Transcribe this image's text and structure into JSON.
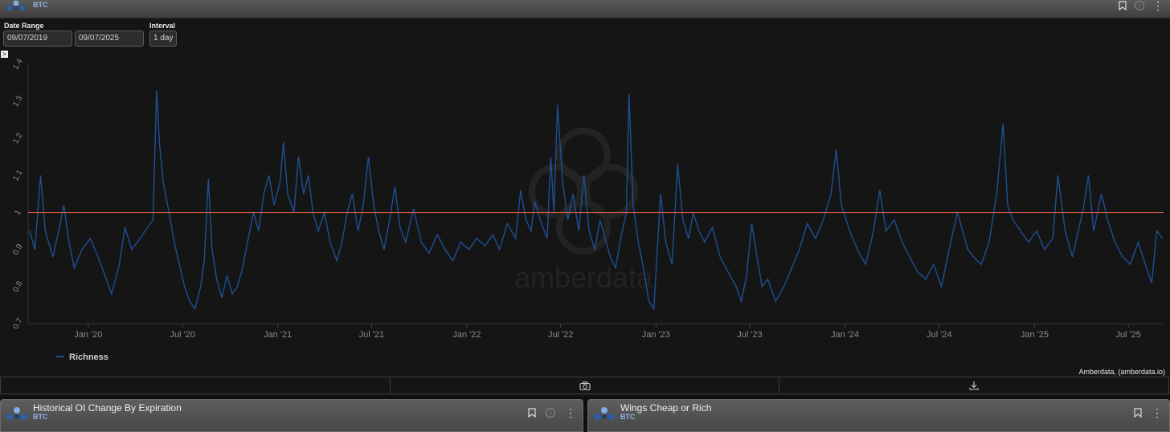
{
  "header": {
    "subtitle": "BTC",
    "info_icon": "info-icon",
    "bookmark_icon": "bookmark-icon",
    "menu_icon": "more-vertical-icon"
  },
  "controls": {
    "date_range_label": "Date Range",
    "start_date": "09/07/2019",
    "end_date": "09/07/2025",
    "interval_label": "Interval",
    "interval_value": "1 day",
    "expand_glyph": ">"
  },
  "watermark": "amberdata",
  "credit": "Amberdata, (amberdata.io)",
  "toolbar": {
    "camera_icon": "camera-icon",
    "download_icon": "download-icon"
  },
  "cards": [
    {
      "title": "Historical OI Change By Expiration",
      "subtitle": "BTC"
    },
    {
      "title": "Wings Cheap or Rich",
      "subtitle": "BTC"
    }
  ],
  "colors": {
    "series": "#1f4f93",
    "reference_line": "#e0604a",
    "background": "#151515"
  },
  "chart_data": {
    "type": "line",
    "xlabel": "",
    "ylabel": "",
    "ylim": [
      0.7,
      1.4
    ],
    "y_ticks": [
      0.7,
      0.8,
      0.9,
      1,
      1.1,
      1.2,
      1.3,
      1.4
    ],
    "y_tick_labels": [
      "0.7",
      "0.8",
      "0.9",
      "1",
      "1.1",
      "1.2",
      "1.3",
      "1.4"
    ],
    "x_range": [
      "2019-09-07",
      "2025-09-07"
    ],
    "x_ticks": [
      "2020-01-01",
      "2020-07-01",
      "2021-01-01",
      "2021-07-01",
      "2022-01-01",
      "2022-07-01",
      "2023-01-01",
      "2023-07-01",
      "2024-01-01",
      "2024-07-01",
      "2025-01-01",
      "2025-07-01"
    ],
    "x_tick_labels": [
      "Jan '20",
      "Jul '20",
      "Jan '21",
      "Jul '21",
      "Jan '22",
      "Jul '22",
      "Jan '23",
      "Jul '23",
      "Jan '24",
      "Jul '24",
      "Jan '25",
      "Jul '25"
    ],
    "reference_line": {
      "y": 1
    },
    "legend": {
      "placement": "bottom-left"
    },
    "grid": false,
    "series": [
      {
        "name": "Richness",
        "points": [
          [
            "2019-09-10",
            0.95
          ],
          [
            "2019-09-20",
            0.9
          ],
          [
            "2019-10-01",
            1.1
          ],
          [
            "2019-10-10",
            0.95
          ],
          [
            "2019-10-25",
            0.88
          ],
          [
            "2019-11-05",
            0.95
          ],
          [
            "2019-11-15",
            1.02
          ],
          [
            "2019-11-25",
            0.92
          ],
          [
            "2019-12-05",
            0.85
          ],
          [
            "2019-12-20",
            0.9
          ],
          [
            "2020-01-05",
            0.93
          ],
          [
            "2020-01-20",
            0.88
          ],
          [
            "2020-02-05",
            0.82
          ],
          [
            "2020-02-15",
            0.78
          ],
          [
            "2020-03-01",
            0.86
          ],
          [
            "2020-03-12",
            0.96
          ],
          [
            "2020-03-25",
            0.9
          ],
          [
            "2020-04-10",
            0.93
          ],
          [
            "2020-04-25",
            0.96
          ],
          [
            "2020-05-05",
            0.98
          ],
          [
            "2020-05-12",
            1.33
          ],
          [
            "2020-05-18",
            1.18
          ],
          [
            "2020-05-25",
            1.08
          ],
          [
            "2020-06-05",
            1.0
          ],
          [
            "2020-06-15",
            0.92
          ],
          [
            "2020-06-25",
            0.86
          ],
          [
            "2020-07-05",
            0.8
          ],
          [
            "2020-07-15",
            0.76
          ],
          [
            "2020-07-25",
            0.74
          ],
          [
            "2020-08-05",
            0.8
          ],
          [
            "2020-08-12",
            0.87
          ],
          [
            "2020-08-20",
            1.09
          ],
          [
            "2020-08-27",
            0.9
          ],
          [
            "2020-09-05",
            0.82
          ],
          [
            "2020-09-15",
            0.77
          ],
          [
            "2020-09-25",
            0.83
          ],
          [
            "2020-10-05",
            0.78
          ],
          [
            "2020-10-15",
            0.8
          ],
          [
            "2020-10-25",
            0.85
          ],
          [
            "2020-11-05",
            0.93
          ],
          [
            "2020-11-15",
            1.0
          ],
          [
            "2020-11-25",
            0.95
          ],
          [
            "2020-12-05",
            1.05
          ],
          [
            "2020-12-15",
            1.1
          ],
          [
            "2020-12-25",
            1.02
          ],
          [
            "2021-01-05",
            1.08
          ],
          [
            "2021-01-12",
            1.19
          ],
          [
            "2021-01-20",
            1.05
          ],
          [
            "2021-02-01",
            1.0
          ],
          [
            "2021-02-10",
            1.15
          ],
          [
            "2021-02-20",
            1.05
          ],
          [
            "2021-03-01",
            1.1
          ],
          [
            "2021-03-10",
            1.0
          ],
          [
            "2021-03-20",
            0.95
          ],
          [
            "2021-04-01",
            1.0
          ],
          [
            "2021-04-12",
            0.92
          ],
          [
            "2021-04-25",
            0.87
          ],
          [
            "2021-05-05",
            0.92
          ],
          [
            "2021-05-15",
            1.0
          ],
          [
            "2021-05-25",
            1.05
          ],
          [
            "2021-06-05",
            0.95
          ],
          [
            "2021-06-15",
            1.02
          ],
          [
            "2021-06-25",
            1.15
          ],
          [
            "2021-07-05",
            1.02
          ],
          [
            "2021-07-15",
            0.95
          ],
          [
            "2021-07-25",
            0.9
          ],
          [
            "2021-08-05",
            0.98
          ],
          [
            "2021-08-15",
            1.07
          ],
          [
            "2021-08-25",
            0.96
          ],
          [
            "2021-09-05",
            0.92
          ],
          [
            "2021-09-20",
            1.01
          ],
          [
            "2021-10-05",
            0.92
          ],
          [
            "2021-10-20",
            0.89
          ],
          [
            "2021-11-05",
            0.94
          ],
          [
            "2021-11-20",
            0.9
          ],
          [
            "2021-12-05",
            0.87
          ],
          [
            "2021-12-20",
            0.92
          ],
          [
            "2022-01-05",
            0.9
          ],
          [
            "2022-01-20",
            0.93
          ],
          [
            "2022-02-05",
            0.91
          ],
          [
            "2022-02-20",
            0.94
          ],
          [
            "2022-03-05",
            0.9
          ],
          [
            "2022-03-20",
            0.97
          ],
          [
            "2022-04-05",
            0.93
          ],
          [
            "2022-04-15",
            1.06
          ],
          [
            "2022-04-25",
            0.98
          ],
          [
            "2022-05-05",
            0.95
          ],
          [
            "2022-05-12",
            1.03
          ],
          [
            "2022-05-25",
            0.97
          ],
          [
            "2022-06-05",
            0.93
          ],
          [
            "2022-06-12",
            1.15
          ],
          [
            "2022-06-18",
            1.0
          ],
          [
            "2022-06-25",
            1.29
          ],
          [
            "2022-07-05",
            1.08
          ],
          [
            "2022-07-15",
            0.98
          ],
          [
            "2022-07-25",
            1.05
          ],
          [
            "2022-08-05",
            0.95
          ],
          [
            "2022-08-15",
            1.1
          ],
          [
            "2022-08-25",
            0.95
          ],
          [
            "2022-09-05",
            0.9
          ],
          [
            "2022-09-15",
            0.98
          ],
          [
            "2022-09-25",
            0.93
          ],
          [
            "2022-10-05",
            0.88
          ],
          [
            "2022-10-15",
            0.85
          ],
          [
            "2022-10-25",
            0.93
          ],
          [
            "2022-11-05",
            1.0
          ],
          [
            "2022-11-10",
            1.32
          ],
          [
            "2022-11-18",
            1.02
          ],
          [
            "2022-11-28",
            0.92
          ],
          [
            "2022-12-08",
            0.85
          ],
          [
            "2022-12-18",
            0.76
          ],
          [
            "2022-12-28",
            0.74
          ],
          [
            "2023-01-10",
            1.05
          ],
          [
            "2023-01-20",
            0.92
          ],
          [
            "2023-02-01",
            0.86
          ],
          [
            "2023-02-12",
            1.13
          ],
          [
            "2023-02-22",
            0.98
          ],
          [
            "2023-03-05",
            0.93
          ],
          [
            "2023-03-14",
            1.0
          ],
          [
            "2023-03-25",
            0.95
          ],
          [
            "2023-04-05",
            0.92
          ],
          [
            "2023-04-20",
            0.96
          ],
          [
            "2023-05-05",
            0.88
          ],
          [
            "2023-05-20",
            0.84
          ],
          [
            "2023-06-05",
            0.8
          ],
          [
            "2023-06-15",
            0.76
          ],
          [
            "2023-06-25",
            0.83
          ],
          [
            "2023-07-05",
            0.97
          ],
          [
            "2023-07-15",
            0.88
          ],
          [
            "2023-07-25",
            0.8
          ],
          [
            "2023-08-05",
            0.82
          ],
          [
            "2023-08-20",
            0.76
          ],
          [
            "2023-09-05",
            0.8
          ],
          [
            "2023-09-20",
            0.85
          ],
          [
            "2023-10-05",
            0.9
          ],
          [
            "2023-10-20",
            0.97
          ],
          [
            "2023-11-05",
            0.93
          ],
          [
            "2023-11-20",
            0.98
          ],
          [
            "2023-12-05",
            1.05
          ],
          [
            "2023-12-15",
            1.17
          ],
          [
            "2023-12-25",
            1.02
          ],
          [
            "2024-01-10",
            0.95
          ],
          [
            "2024-01-25",
            0.9
          ],
          [
            "2024-02-10",
            0.86
          ],
          [
            "2024-02-25",
            0.95
          ],
          [
            "2024-03-08",
            1.06
          ],
          [
            "2024-03-20",
            0.95
          ],
          [
            "2024-04-05",
            0.98
          ],
          [
            "2024-04-20",
            0.92
          ],
          [
            "2024-05-05",
            0.88
          ],
          [
            "2024-05-20",
            0.84
          ],
          [
            "2024-06-05",
            0.82
          ],
          [
            "2024-06-20",
            0.86
          ],
          [
            "2024-07-05",
            0.8
          ],
          [
            "2024-07-20",
            0.9
          ],
          [
            "2024-08-05",
            1.0
          ],
          [
            "2024-08-15",
            0.95
          ],
          [
            "2024-08-25",
            0.9
          ],
          [
            "2024-09-05",
            0.88
          ],
          [
            "2024-09-20",
            0.86
          ],
          [
            "2024-10-05",
            0.92
          ],
          [
            "2024-10-20",
            1.05
          ],
          [
            "2024-11-01",
            1.24
          ],
          [
            "2024-11-10",
            1.02
          ],
          [
            "2024-11-20",
            0.98
          ],
          [
            "2024-12-05",
            0.95
          ],
          [
            "2024-12-20",
            0.92
          ],
          [
            "2025-01-05",
            0.95
          ],
          [
            "2025-01-20",
            0.9
          ],
          [
            "2025-02-05",
            0.93
          ],
          [
            "2025-02-15",
            1.1
          ],
          [
            "2025-03-01",
            0.95
          ],
          [
            "2025-03-15",
            0.88
          ],
          [
            "2025-04-05",
            1.01
          ],
          [
            "2025-04-15",
            1.1
          ],
          [
            "2025-04-25",
            0.95
          ],
          [
            "2025-05-10",
            1.05
          ],
          [
            "2025-05-22",
            0.98
          ],
          [
            "2025-06-05",
            0.92
          ],
          [
            "2025-06-20",
            0.88
          ],
          [
            "2025-07-05",
            0.86
          ],
          [
            "2025-07-20",
            0.92
          ],
          [
            "2025-08-05",
            0.85
          ],
          [
            "2025-08-15",
            0.81
          ],
          [
            "2025-08-25",
            0.95
          ],
          [
            "2025-09-05",
            0.93
          ]
        ]
      }
    ]
  }
}
